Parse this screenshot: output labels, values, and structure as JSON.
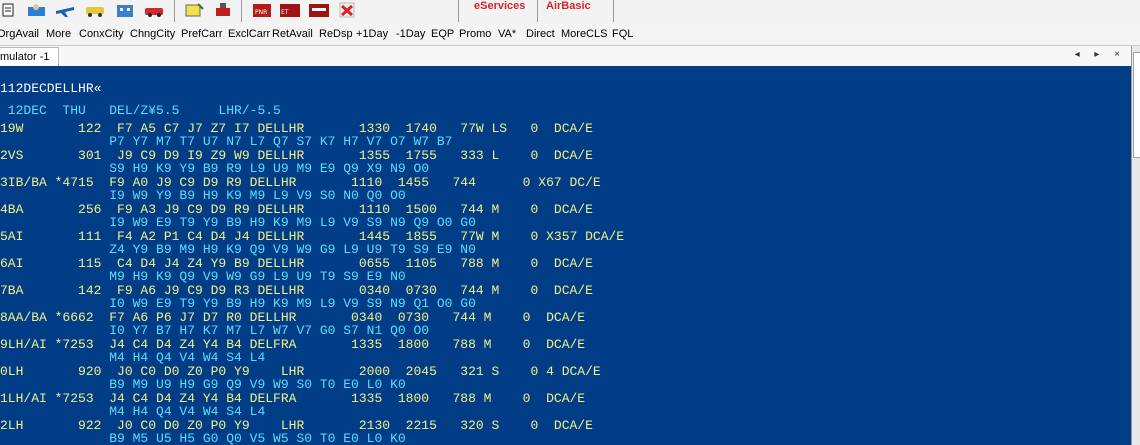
{
  "toolbar": {
    "icons": [
      "new-icon",
      "agent-icon",
      "flight-icon",
      "car-icon",
      "hotel-icon",
      "tour-icon",
      "note-icon",
      "trash-icon",
      "pnr-icon",
      "etpnr-icon",
      "docimp-icon",
      "exit-icon"
    ],
    "eservices_label": "eServices",
    "airbasic_label": "AirBasic",
    "colors": {
      "brand_red": "#d2262b"
    }
  },
  "cmdbar": {
    "items": [
      "OrgAvail",
      "More",
      "ConxCity",
      "ChngCity",
      "PrefCarr",
      "ExclCarr",
      "RetAvail",
      "ReDsp",
      "+1Day",
      "-1Day",
      "EQP",
      "Promo",
      "VA*",
      "Direct",
      "MoreCLS",
      "FQL"
    ]
  },
  "tab": {
    "label": "mulator -1",
    "controls": "◂ ▸ ×"
  },
  "terminal": {
    "colors": {
      "background": "#003d86",
      "command": "#ffffff",
      "header": "#56e0ff",
      "flight": "#f2f08c"
    },
    "command": "112DECDELLHR«",
    "header": " 12DEC  THU   DEL/Z¥5.5     LHR/-5.5",
    "flights": [
      {
        "main": "19W       122  F7 A5 C7 J7 Z7 I7 DELLHR       1330  1740   77W LS   0  DCA/E",
        "classes": "              P7 Y7 M7 T7 U7 N7 L7 Q7 S7 K7 H7 V7 O7 W7 B7"
      },
      {
        "main": "2VS       301  J9 C9 D9 I9 Z9 W9 DELLHR       1355  1755   333 L    0  DCA/E",
        "classes": "              S9 H9 K9 Y9 B9 R9 L9 U9 M9 E9 Q9 X9 N9 O0"
      },
      {
        "main": "3IB/BA *4715  F9 A0 J9 C9 D9 R9 DELLHR       1110  1455   744      0 X67 DC/E",
        "classes": "              I9 W9 Y9 B9 H9 K9 M9 L9 V9 S0 N0 Q0 O0"
      },
      {
        "main": "4BA       256  F9 A3 J9 C9 D9 R9 DELLHR       1110  1500   744 M    0  DCA/E",
        "classes": "              I9 W9 E9 T9 Y9 B9 H9 K9 M9 L9 V9 S9 N9 Q9 O0 G0"
      },
      {
        "main": "5AI       111  F4 A2 P1 C4 D4 J4 DELLHR       1445  1855   77W M    0 X357 DCA/E",
        "classes": "              Z4 Y9 B9 M9 H9 K9 Q9 V9 W9 G9 L9 U9 T9 S9 E9 N0"
      },
      {
        "main": "6AI       115  C4 D4 J4 Z4 Y9 B9 DELLHR       0655  1105   788 M    0  DCA/E",
        "classes": "              M9 H9 K9 Q9 V9 W9 G9 L9 U9 T9 S9 E9 N0"
      },
      {
        "main": "7BA       142  F9 A6 J9 C9 D9 R3 DELLHR       0340  0730   744 M    0  DCA/E",
        "classes": "              I0 W9 E9 T9 Y9 B9 H9 K9 M9 L9 V9 S9 N9 Q1 O0 G0"
      },
      {
        "main": "8AA/BA *6662  F7 A6 P6 J7 D7 R0 DELLHR       0340  0730   744 M    0  DCA/E",
        "classes": "              I0 Y7 B7 H7 K7 M7 L7 W7 V7 G0 S7 N1 Q0 O0"
      },
      {
        "main": "9LH/AI *7253  J4 C4 D4 Z4 Y4 B4 DELFRA       1335  1800   788 M    0  DCA/E",
        "classes": "              M4 H4 Q4 V4 W4 S4 L4"
      },
      {
        "main": "0LH       920  J0 C0 D0 Z0 P0 Y9    LHR       2000  2045   321 S    0 4 DCA/E",
        "classes": "              B9 M9 U9 H9 G9 Q9 V9 W9 S0 T0 E0 L0 K0"
      },
      {
        "main": "1LH/AI *7253  J4 C4 D4 Z4 Y4 B4 DELFRA       1335  1800   788 M    0  DCA/E",
        "classes": "              M4 H4 Q4 V4 W4 S4 L4"
      },
      {
        "main": "2LH       922  J0 C0 D0 Z0 P0 Y9    LHR       2130  2215   320 S    0  DCA/E",
        "classes": "              B9 M5 U5 H5 G0 Q0 V5 W5 S0 T0 E0 L0 K0"
      }
    ]
  }
}
